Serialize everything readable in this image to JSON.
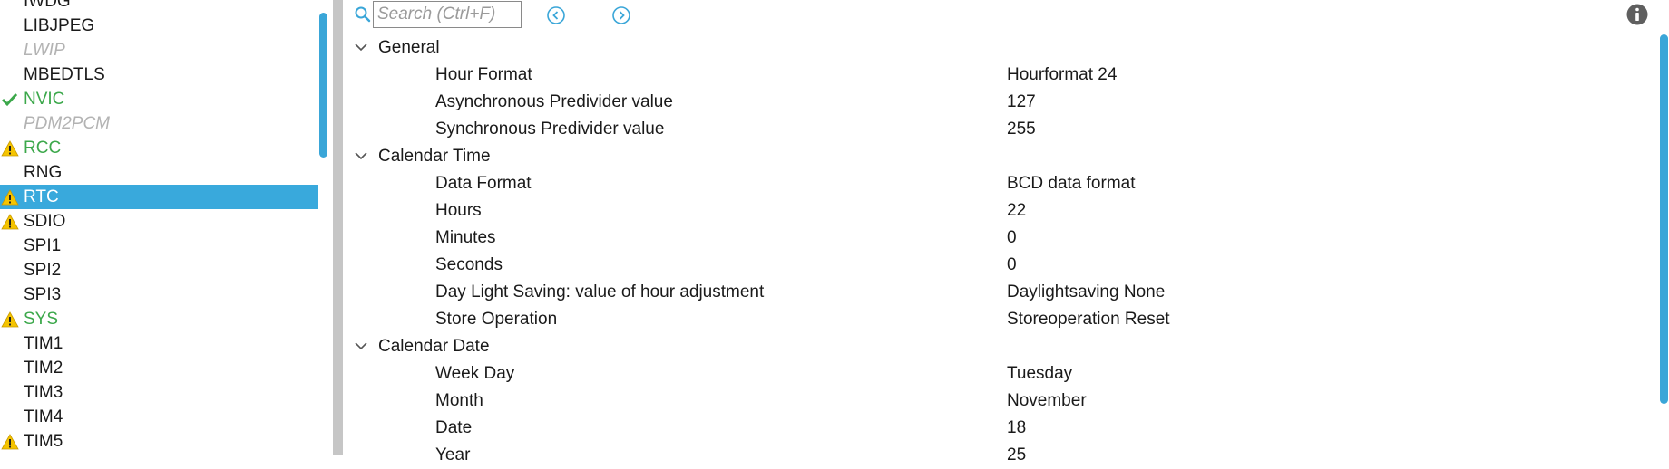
{
  "sidebar": {
    "items": [
      {
        "label": "IWDG",
        "state": "normal",
        "icon": ""
      },
      {
        "label": "LIBJPEG",
        "state": "normal",
        "icon": ""
      },
      {
        "label": "LWIP",
        "state": "disabled",
        "icon": ""
      },
      {
        "label": "MBEDTLS",
        "state": "normal",
        "icon": ""
      },
      {
        "label": "NVIC",
        "state": "enabled",
        "icon": "check-icon"
      },
      {
        "label": "PDM2PCM",
        "state": "disabled",
        "icon": ""
      },
      {
        "label": "RCC",
        "state": "enabled",
        "icon": "warning-icon"
      },
      {
        "label": "RNG",
        "state": "normal",
        "icon": ""
      },
      {
        "label": "RTC",
        "state": "selected",
        "icon": "warning-icon"
      },
      {
        "label": "SDIO",
        "state": "normal",
        "icon": "warning-icon"
      },
      {
        "label": "SPI1",
        "state": "normal",
        "icon": ""
      },
      {
        "label": "SPI2",
        "state": "normal",
        "icon": ""
      },
      {
        "label": "SPI3",
        "state": "normal",
        "icon": ""
      },
      {
        "label": "SYS",
        "state": "enabled",
        "icon": "warning-icon"
      },
      {
        "label": "TIM1",
        "state": "normal",
        "icon": ""
      },
      {
        "label": "TIM2",
        "state": "normal",
        "icon": ""
      },
      {
        "label": "TIM3",
        "state": "normal",
        "icon": ""
      },
      {
        "label": "TIM4",
        "state": "normal",
        "icon": ""
      },
      {
        "label": "TIM5",
        "state": "normal",
        "icon": "warning-icon"
      }
    ]
  },
  "toolbar": {
    "search_placeholder": "Search (Ctrl+F)",
    "prev_icon": "chevron-left-circle-icon",
    "next_icon": "chevron-right-circle-icon",
    "info_icon": "info-icon"
  },
  "groups": [
    {
      "name": "General",
      "params": [
        {
          "name": "Hour Format",
          "value": "Hourformat 24"
        },
        {
          "name": "Asynchronous Predivider value",
          "value": "127"
        },
        {
          "name": "Synchronous Predivider value",
          "value": "255"
        }
      ]
    },
    {
      "name": "Calendar Time",
      "params": [
        {
          "name": "Data Format",
          "value": "BCD data format"
        },
        {
          "name": "Hours",
          "value": "22"
        },
        {
          "name": "Minutes",
          "value": "0"
        },
        {
          "name": "Seconds",
          "value": "0"
        },
        {
          "name": "Day Light Saving: value of hour adjustment",
          "value": "Daylightsaving None"
        },
        {
          "name": "Store Operation",
          "value": "Storeoperation Reset"
        }
      ]
    },
    {
      "name": "Calendar Date",
      "params": [
        {
          "name": "Week Day",
          "value": "Tuesday"
        },
        {
          "name": "Month",
          "value": "November"
        },
        {
          "name": "Date",
          "value": "18"
        },
        {
          "name": "Year",
          "value": "25"
        }
      ]
    }
  ],
  "colors": {
    "accent": "#39a9dc",
    "enabled_text": "#3ca84b",
    "disabled_text": "#b3b3b3",
    "warning": "#f5c400"
  }
}
